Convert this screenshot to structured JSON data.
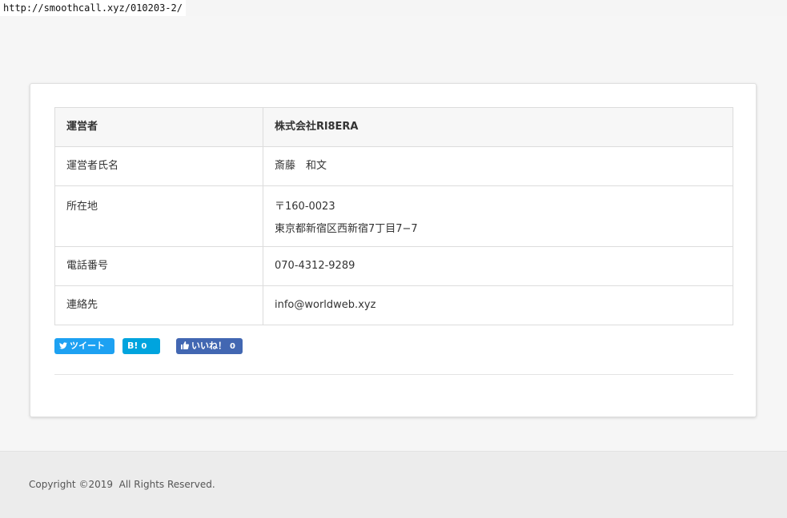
{
  "browser": {
    "url": "http://smoothcall.xyz/010203-2/"
  },
  "company_table": {
    "header": {
      "label": "運営者",
      "value": "株式会社Rl8ERA"
    },
    "rows": [
      {
        "label": "運営者氏名",
        "value": "斎藤　和文"
      },
      {
        "label": "所在地",
        "value_lines": [
          "〒160-0023",
          "東京都新宿区西新宿7丁目7−7"
        ]
      },
      {
        "label": "電話番号",
        "value": "070-4312-9289"
      },
      {
        "label": "連絡先",
        "value": "info@worldweb.xyz"
      }
    ]
  },
  "share": {
    "tweet": {
      "icon": "twitter-bird-icon",
      "label": "ツイート",
      "color": "#1da1f2"
    },
    "hatena": {
      "icon": "hatena-bookmark-icon",
      "label": "B!",
      "count": "0",
      "color": "#00a4de"
    },
    "like": {
      "icon": "thumbs-up-icon",
      "label": "いいね！",
      "count": "0",
      "color": "#4267b2"
    }
  },
  "footer": {
    "copyright": "Copyright ©2019  All Rights Reserved."
  }
}
